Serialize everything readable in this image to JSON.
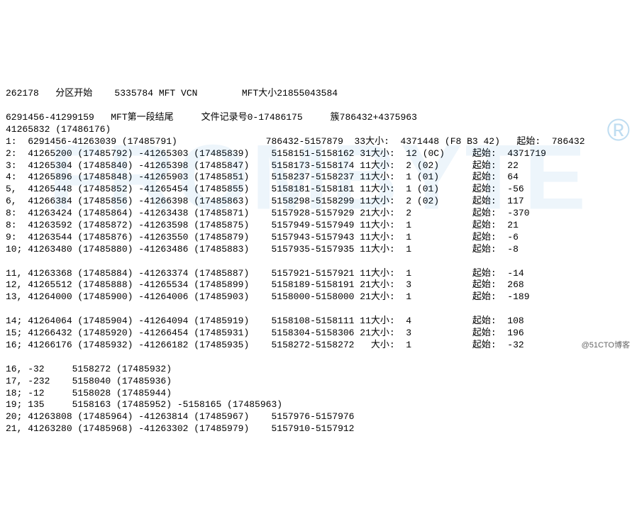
{
  "hdr1": "262178   分区开始    5335784 MFT VCN        MFT大小21855043584",
  "hdr2": "6291456-41299159   MFT第一段结尾     文件记录号0-17486175     簇786432+4375963",
  "hdr3": "41265832 (17486176)",
  "rows": [
    "1:  6291456-41263039 (17485791)                786432-5157879  33大小:  4371448 (F8 B3 42)   起始:  786432",
    "2:  41265200 (17485792) -41265303 (17485839)    5158151-5158162 31大小:  12 (0C)     起始:  4371719",
    "3:  41265304 (17485840) -41265398 (17485847)    5158173-5158174 11大小:  2 (02)      起始:  22",
    "4:  41265896 (17485848) -41265903 (17485851)    5158237-5158237 11大小:  1 (01)      起始:  64",
    "5,  41265448 (17485852) -41265454 (17485855)    5158181-5158181 11大小:  1 (01)      起始:  -56",
    "6,  41266384 (17485856) -41266398 (17485863)    5158298-5158299 11大小:  2 (02)      起始:  117",
    "8:  41263424 (17485864) -41263438 (17485871)    5157928-5157929 21大小:  2           起始:  -370",
    "8:  41263592 (17485872) -41263598 (17485875)    5157949-5157949 11大小:  1           起始:  21",
    "9:  41263544 (17485876) -41263550 (17485879)    5157943-5157943 11大小:  1           起始:  -6",
    "10; 41263480 (17485880) -41263486 (17485883)    5157935-5157935 11大小:  1           起始:  -8",
    "",
    "11, 41263368 (17485884) -41263374 (17485887)    5157921-5157921 11大小:  1           起始:  -14",
    "12, 41265512 (17485888) -41265534 (17485899)    5158189-5158191 21大小:  3           起始:  268",
    "13, 41264000 (17485900) -41264006 (17485903)    5158000-5158000 21大小:  1           起始:  -189",
    "",
    "14; 41264064 (17485904) -41264094 (17485919)    5158108-5158111 11大小:  4           起始:  108",
    "15; 41266432 (17485920) -41266454 (17485931)    5158304-5158306 21大小:  3           起始:  196",
    "16; 41266176 (17485932) -41266182 (17485935)    5158272-5158272   大小:  1           起始:  -32",
    "",
    "16, -32     5158272 (17485932)",
    "17, -232    5158040 (17485936)",
    "18; -12     5158028 (17485944)",
    "19; 135     5158163 (17485952) -5158165 (17485963)",
    "20; 41263808 (17485964) -41263814 (17485967)    5157976-5157976",
    "21, 41263280 (17485968) -41263302 (17485979)    5157910-5157912"
  ],
  "watermark": "FROMBYTE",
  "reg": "®",
  "attrib": "@51CTO博客"
}
